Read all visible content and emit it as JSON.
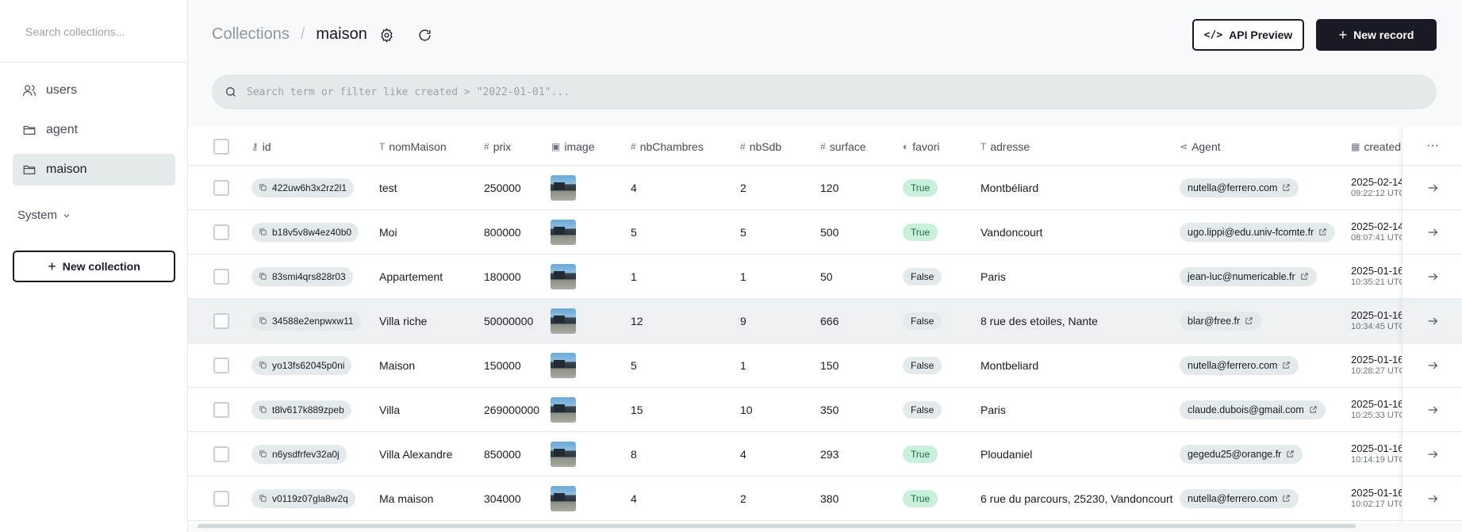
{
  "sidebar": {
    "search_placeholder": "Search collections...",
    "items": [
      {
        "label": "users",
        "icon": "users-icon"
      },
      {
        "label": "agent",
        "icon": "folder-icon"
      },
      {
        "label": "maison",
        "icon": "folder-icon",
        "active": true
      }
    ],
    "system_label": "System",
    "new_collection_label": "New collection"
  },
  "header": {
    "breadcrumb_root": "Collections",
    "breadcrumb_separator": "/",
    "breadcrumb_current": "maison",
    "api_preview_label": "API Preview",
    "new_record_label": "New record"
  },
  "search": {
    "placeholder": "Search term or filter like created > \"2022-01-01\"..."
  },
  "table": {
    "columns": [
      {
        "label": "id",
        "icon": "key-icon"
      },
      {
        "label": "nomMaison",
        "icon": "text-icon"
      },
      {
        "label": "prix",
        "icon": "number-icon"
      },
      {
        "label": "image",
        "icon": "image-icon"
      },
      {
        "label": "nbChambres",
        "icon": "number-icon"
      },
      {
        "label": "nbSdb",
        "icon": "number-icon"
      },
      {
        "label": "surface",
        "icon": "number-icon"
      },
      {
        "label": "favori",
        "icon": "toggle-icon"
      },
      {
        "label": "adresse",
        "icon": "text-icon"
      },
      {
        "label": "Agent",
        "icon": "relation-icon"
      },
      {
        "label": "created",
        "icon": "calendar-icon"
      }
    ],
    "rows": [
      {
        "id": "422uw6h3x2rz2l1",
        "nomMaison": "test",
        "prix": "250000",
        "nbChambres": "4",
        "nbSdb": "2",
        "surface": "120",
        "favori": "True",
        "adresse": "Montbéliard",
        "agent": "nutella@ferrero.com",
        "created_date": "2025-02-14",
        "created_time": "09:22:12 UTC"
      },
      {
        "id": "b18v5v8w4ez40b0",
        "nomMaison": "Moi",
        "prix": "800000",
        "nbChambres": "5",
        "nbSdb": "5",
        "surface": "500",
        "favori": "True",
        "adresse": "Vandoncourt",
        "agent": "ugo.lippi@edu.univ-fcomte.fr",
        "created_date": "2025-02-14",
        "created_time": "08:07:41 UTC"
      },
      {
        "id": "83smi4qrs828r03",
        "nomMaison": "Appartement",
        "prix": "180000",
        "nbChambres": "1",
        "nbSdb": "1",
        "surface": "50",
        "favori": "False",
        "adresse": "Paris",
        "agent": "jean-luc@numericable.fr",
        "created_date": "2025-01-16",
        "created_time": "10:35:21 UTC"
      },
      {
        "id": "34588e2enpwxw11",
        "nomMaison": "Villa riche",
        "prix": "50000000",
        "nbChambres": "12",
        "nbSdb": "9",
        "surface": "666",
        "favori": "False",
        "adresse": "8 rue des etoiles, Nante",
        "agent": "blar@free.fr",
        "created_date": "2025-01-16",
        "created_time": "10:34:45 UTC"
      },
      {
        "id": "yo13fs62045p0ni",
        "nomMaison": "Maison",
        "prix": "150000",
        "nbChambres": "5",
        "nbSdb": "1",
        "surface": "150",
        "favori": "False",
        "adresse": "Montbeliard",
        "agent": "nutella@ferrero.com",
        "created_date": "2025-01-16",
        "created_time": "10:28:27 UTC"
      },
      {
        "id": "t8lv617k889zpeb",
        "nomMaison": "Villa",
        "prix": "269000000",
        "nbChambres": "15",
        "nbSdb": "10",
        "surface": "350",
        "favori": "False",
        "adresse": "Paris",
        "agent": "claude.dubois@gmail.com",
        "created_date": "2025-01-16",
        "created_time": "10:25:33 UTC"
      },
      {
        "id": "n6ysdfrfev32a0j",
        "nomMaison": "Villa Alexandre",
        "prix": "850000",
        "nbChambres": "8",
        "nbSdb": "4",
        "surface": "293",
        "favori": "True",
        "adresse": "Ploudaniel",
        "agent": "gegedu25@orange.fr",
        "created_date": "2025-01-16",
        "created_time": "10:14:19 UTC"
      },
      {
        "id": "v0119z07gla8w2q",
        "nomMaison": "Ma maison",
        "prix": "304000",
        "nbChambres": "4",
        "nbSdb": "2",
        "surface": "380",
        "favori": "True",
        "adresse": "6 rue du parcours, 25230, Vandoncourt",
        "agent": "nutella@ferrero.com",
        "created_date": "2025-01-16",
        "created_time": "10:02:17 UTC"
      }
    ]
  },
  "colors": {
    "primary": "#1a1a24",
    "sidebar_active": "#e4e9ec",
    "true_badge": "#c9f0dc",
    "false_badge": "#e4e9ec"
  }
}
